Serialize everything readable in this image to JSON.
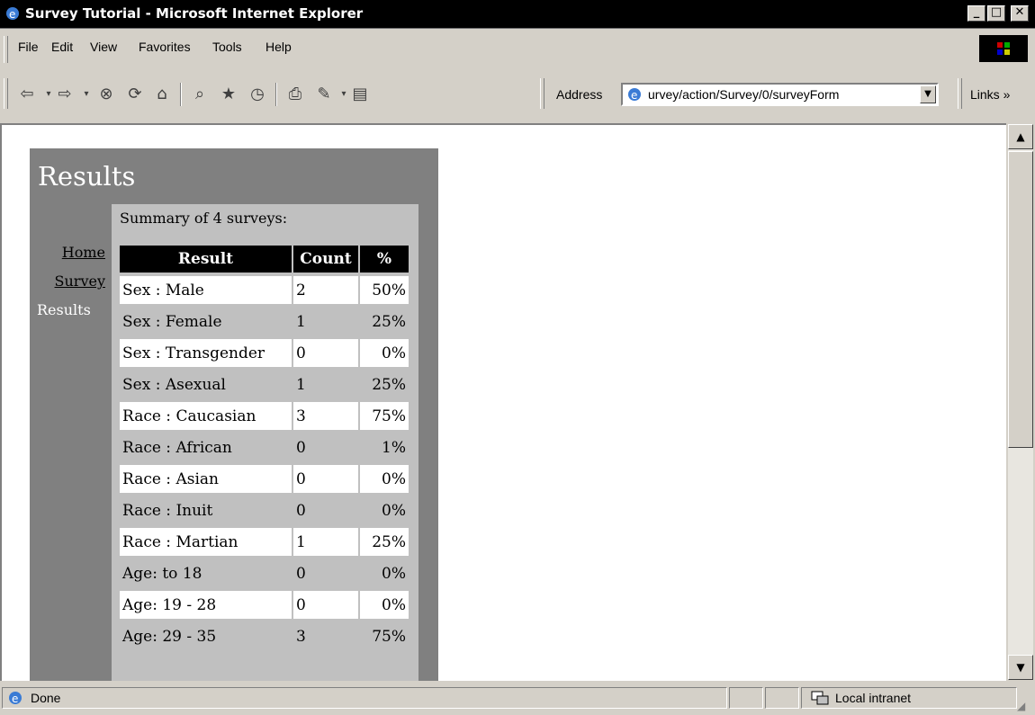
{
  "window": {
    "title": "Survey Tutorial - Microsoft Internet Explorer",
    "minimize": "_",
    "maximize": "□",
    "close": "✕"
  },
  "menu": {
    "items": [
      {
        "label": "File"
      },
      {
        "label": "Edit"
      },
      {
        "label": "View"
      },
      {
        "label": "Favorites"
      },
      {
        "label": "Tools"
      },
      {
        "label": "Help"
      }
    ]
  },
  "toolbar": {
    "address_label": "Address",
    "address_value": "urvey/action/Survey/0/surveyForm",
    "links_label": "Links »"
  },
  "page": {
    "title": "Results",
    "nav": {
      "home": "Home",
      "survey": "Survey",
      "results": "Results"
    },
    "summary": "Summary of 4 surveys:",
    "table": {
      "headers": [
        "Result",
        "Count",
        "%"
      ],
      "rows": [
        {
          "result": "Sex : Male",
          "count": "2",
          "pct": "50%"
        },
        {
          "result": "Sex : Female",
          "count": "1",
          "pct": "25%"
        },
        {
          "result": "Sex : Transgender",
          "count": "0",
          "pct": "0%"
        },
        {
          "result": "Sex : Asexual",
          "count": "1",
          "pct": "25%"
        },
        {
          "result": "Race : Caucasian",
          "count": "3",
          "pct": "75%"
        },
        {
          "result": "Race : African",
          "count": "0",
          "pct": "1%"
        },
        {
          "result": "Race : Asian",
          "count": "0",
          "pct": "0%"
        },
        {
          "result": "Race : Inuit",
          "count": "0",
          "pct": "0%"
        },
        {
          "result": "Race : Martian",
          "count": "1",
          "pct": "25%"
        },
        {
          "result": "Age: to 18",
          "count": "0",
          "pct": "0%"
        },
        {
          "result": "Age: 19 - 28",
          "count": "0",
          "pct": "0%"
        },
        {
          "result": "Age: 29 - 35",
          "count": "3",
          "pct": "75%"
        }
      ]
    }
  },
  "status": {
    "text": "Done",
    "zone": "Local intranet"
  }
}
